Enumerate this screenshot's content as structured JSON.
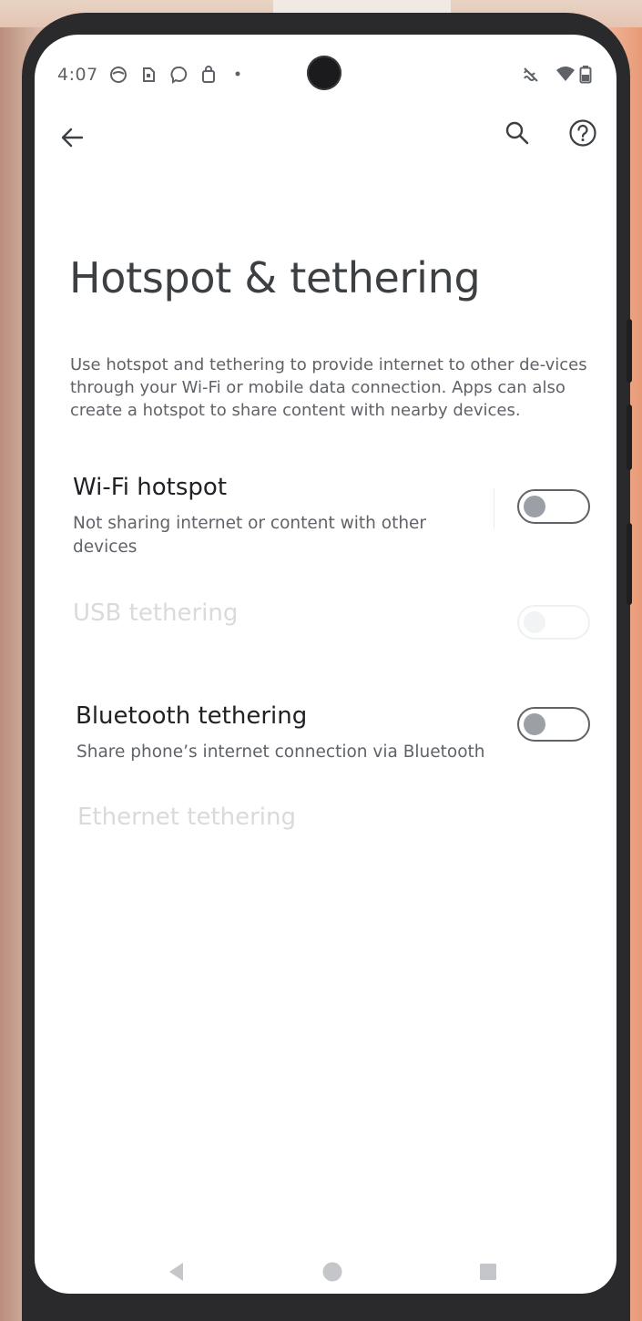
{
  "status_bar": {
    "time": "4:07",
    "notification_icons": [
      "alarm-icon",
      "sim-card-icon",
      "messenger-icon",
      "shopping-bag-icon",
      "dot-icon"
    ],
    "system_icons": [
      "vibrate-off-icon",
      "wifi-icon",
      "battery-icon"
    ]
  },
  "app_bar": {
    "back_icon": "arrow-back-icon",
    "search_icon": "search-icon",
    "help_icon": "help-icon"
  },
  "page": {
    "title": "Hotspot & tethering",
    "description": "Use hotspot and tethering to provide internet to other de-vices through your Wi-Fi or mobile data connection. Apps can also create a hotspot to share content with nearby devices."
  },
  "settings": {
    "wifi_hotspot": {
      "title": "Wi-Fi hotspot",
      "summary": "Not sharing internet or content with other devices",
      "enabled": true,
      "checked": false
    },
    "usb_tethering": {
      "title": "USB tethering",
      "summary": "",
      "enabled": false,
      "checked": false
    },
    "bluetooth_tethering": {
      "title": "Bluetooth tethering",
      "summary": "Share phone’s internet connection via Bluetooth",
      "enabled": true,
      "checked": false
    },
    "ethernet_tethering": {
      "title": "Ethernet tethering",
      "summary": "",
      "enabled": false,
      "checked": false
    }
  },
  "nav_bar": {
    "back": "triangle-back-icon",
    "home": "circle-home-icon",
    "recents": "square-recents-icon"
  },
  "colors": {
    "text_primary": "#202124",
    "text_secondary": "#5f6368",
    "switch_off_track": "#5f6368",
    "switch_off_thumb": "#9aa0a6",
    "background": "#ffffff"
  }
}
